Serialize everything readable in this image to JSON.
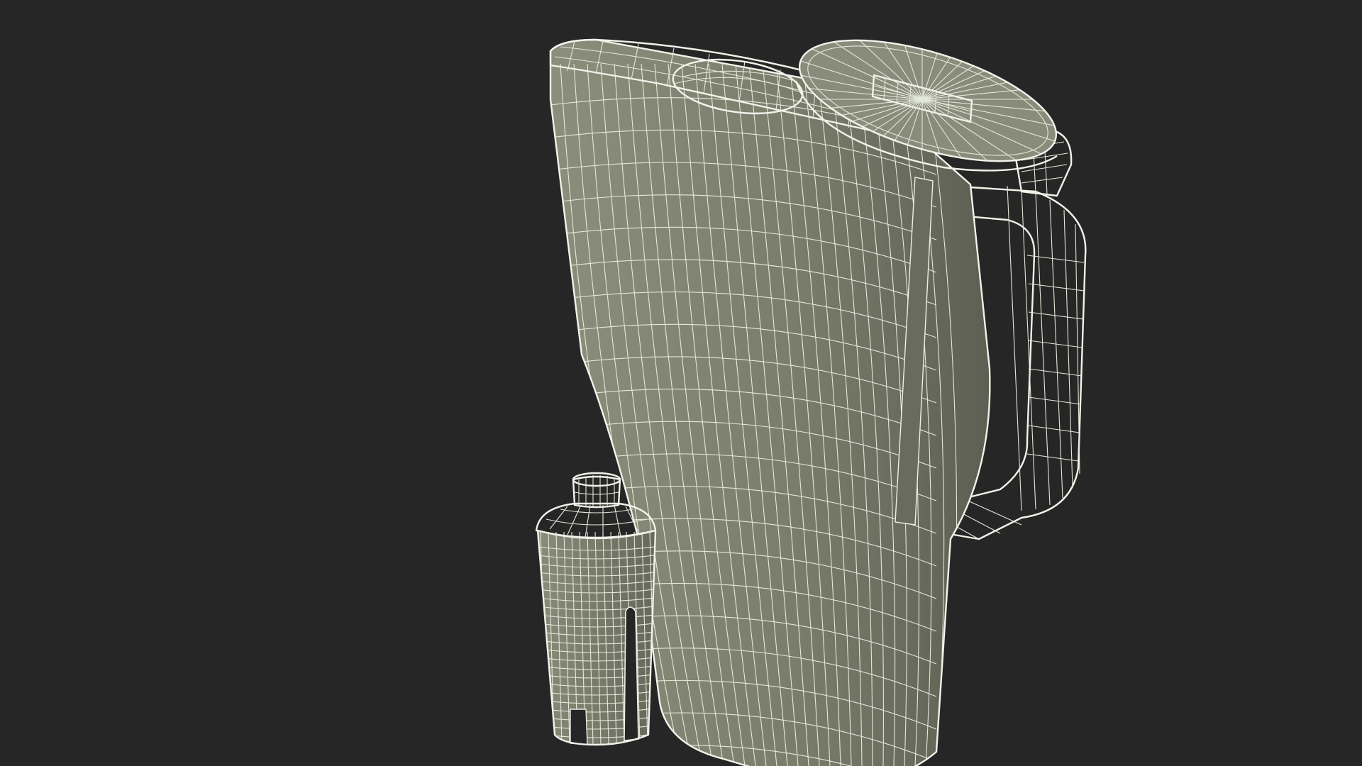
{
  "viewport": {
    "background_color": "#262626"
  },
  "colors": {
    "surface": "#7b7d6c",
    "surface_dark": "#5d5f52",
    "surface_light": "#8c8e7c",
    "wire": "#e9ecdf",
    "interior": "#111111"
  },
  "objects": [
    {
      "name": "pitcher-body",
      "label": ""
    },
    {
      "name": "pitcher-lid",
      "label": ""
    },
    {
      "name": "pitcher-handle",
      "label": ""
    },
    {
      "name": "filter-cartridge",
      "label": ""
    }
  ]
}
